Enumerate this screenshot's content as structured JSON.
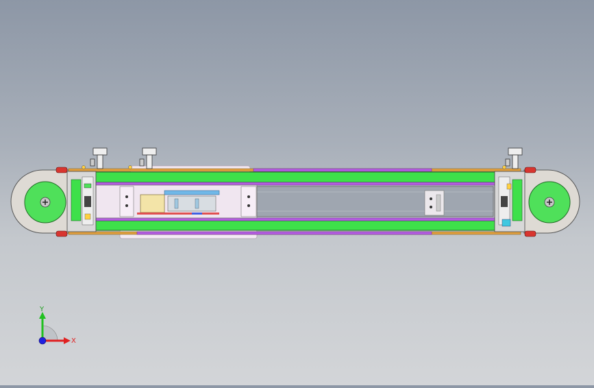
{
  "viewport": {
    "background_top": "#8d97a6",
    "background_bottom": "#d3d5d8"
  },
  "colors": {
    "frame_green": "#3ee04a",
    "wheel_green": "#4fe05a",
    "belt_purple": "#b45ee0",
    "belt_orange": "#e0a040",
    "roller_red": "#d8352f",
    "plate_pink": "#efe0ef",
    "axis_x": "#e02020",
    "axis_y": "#20c020",
    "axis_z": "#2020e0"
  },
  "triad": {
    "x_label": "X",
    "y_label": "Y",
    "icons": [
      "axis-x-arrow-icon",
      "axis-y-arrow-icon",
      "origin-icon"
    ]
  }
}
